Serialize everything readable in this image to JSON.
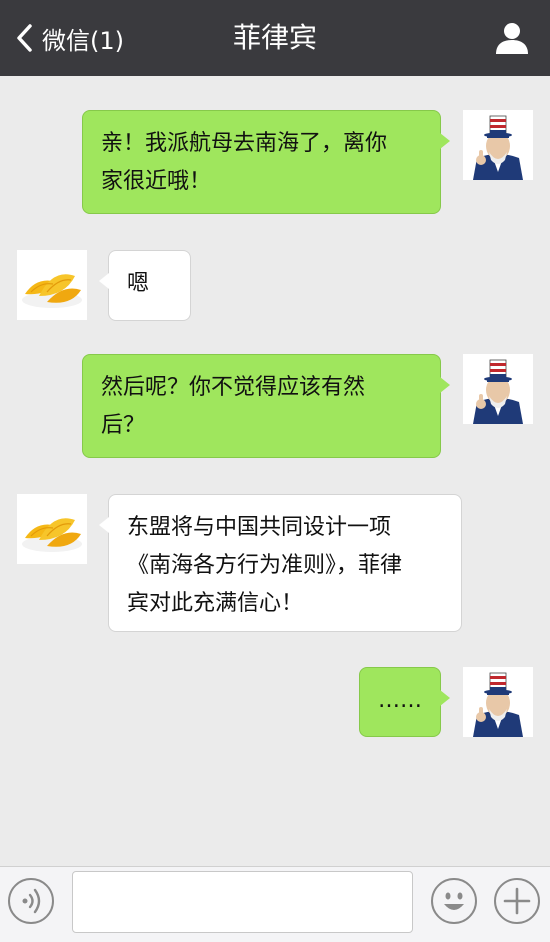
{
  "header": {
    "back_label": "微信(1)",
    "title": "菲律宾"
  },
  "messages": [
    {
      "side": "right",
      "text_lines": [
        "亲！我派航母去南海了，离你",
        "家很近哦！"
      ],
      "avatar": "uncle-sam-avatar"
    },
    {
      "side": "left",
      "text_lines": [
        "嗯"
      ],
      "avatar": "mango-avatar"
    },
    {
      "side": "right",
      "text_lines": [
        "然后呢？你不觉得应该有然",
        "后？"
      ],
      "avatar": "uncle-sam-avatar"
    },
    {
      "side": "left",
      "text_lines": [
        "东盟将与中国共同设计一项",
        "《南海各方行为准则》，菲律",
        "宾对此充满信心！"
      ],
      "avatar": "mango-avatar"
    },
    {
      "side": "right",
      "text_lines": [
        "……"
      ],
      "avatar": "uncle-sam-avatar"
    }
  ],
  "input": {
    "value": "",
    "placeholder": ""
  },
  "icons": {
    "back": "chevron-left-icon",
    "user": "user-icon",
    "voice": "voice-icon",
    "emoji": "emoji-icon",
    "plus": "plus-icon"
  },
  "colors": {
    "navbar": "#3a3a3e",
    "background": "#ebebeb",
    "outgoing_bubble": "#9fe65d",
    "incoming_bubble": "#ffffff"
  }
}
